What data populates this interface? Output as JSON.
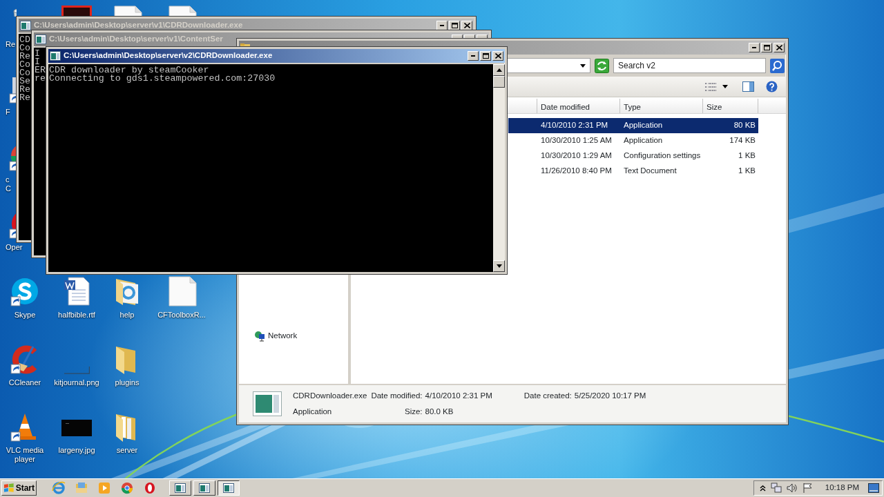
{
  "desktop_columns": [
    [
      {
        "kind": "recycle",
        "label": "Re",
        "cut": true
      },
      {
        "kind": "app",
        "label": "F",
        "cut": true,
        "shortcut": true
      },
      {
        "kind": "chrome",
        "label": "c\nC",
        "cut": true,
        "shortcut": true
      },
      {
        "kind": "opera",
        "label": "Oper",
        "cut": true,
        "shortcut": true
      },
      {
        "kind": "skype",
        "label": "Skype",
        "shortcut": true
      },
      {
        "kind": "ccleaner",
        "label": "CCleaner",
        "shortcut": true
      },
      {
        "kind": "vlc",
        "label": "VLC media player",
        "shortcut": true
      }
    ],
    [
      {
        "kind": "redapp"
      },
      {
        "kind": "worddoc",
        "label": "halfbible.rtf"
      },
      {
        "kind": "blankimage",
        "label": "kitjournal.png"
      },
      {
        "kind": "darkimage",
        "label": "largeny.jpg"
      }
    ],
    [
      {
        "kind": "document"
      },
      {
        "kind": "iefolder",
        "label": "help"
      },
      {
        "kind": "folder",
        "label": "plugins"
      },
      {
        "kind": "docfolder",
        "label": "server"
      }
    ],
    [
      {
        "kind": "document"
      },
      {
        "kind": "document",
        "label": "CFToolboxR..."
      }
    ]
  ],
  "windows": [
    {
      "kind": "console",
      "title": "C:\\Users\\admin\\Desktop\\server\\v1\\CDRDownloader.exe",
      "active": false,
      "lines": [
        "CD",
        "Co",
        "Re",
        "Co",
        "Co",
        "Se",
        "Re",
        "Re"
      ]
    },
    {
      "kind": "console",
      "title": "C:\\Users\\admin\\Desktop\\server\\v1\\ContentSer",
      "active": false,
      "lines": [
        "I",
        "I",
        "ER",
        "re"
      ]
    },
    {
      "kind": "explorer",
      "active": false,
      "search": {
        "placeholder": "Search v2"
      },
      "columns": [
        "Date modified",
        "Type",
        "Size"
      ],
      "rows": [
        {
          "date": "4/10/2010 2:31 PM",
          "type": "Application",
          "size": "80 KB",
          "selected": true
        },
        {
          "date": "10/30/2010 1:25 AM",
          "type": "Application",
          "size": "174 KB",
          "selected": false
        },
        {
          "date": "10/30/2010 1:29 AM",
          "type": "Configuration settings",
          "size": "1 KB",
          "selected": false
        },
        {
          "date": "11/26/2010 8:40 PM",
          "type": "Text Document",
          "size": "1 KB",
          "selected": false
        }
      ],
      "nav": [
        {
          "label": "Network"
        }
      ],
      "details": {
        "name": "CDRDownloader.exe",
        "type": "Application",
        "fields": [
          {
            "label": "Date modified:",
            "value": "4/10/2010 2:31 PM"
          },
          {
            "label": "Date created:",
            "value": "5/25/2020 10:17 PM"
          },
          {
            "label": "Size:",
            "value": "80.0 KB"
          }
        ]
      }
    },
    {
      "kind": "console",
      "title": "C:\\Users\\admin\\Desktop\\server\\v2\\CDRDownloader.exe",
      "active": true,
      "scrollbar": true,
      "lines": [
        "CDR downloader by steamCooker",
        "Connecting to gds1.steampowered.com:27030"
      ]
    }
  ],
  "taskbar": {
    "start": "Start",
    "quick_launch": [
      {
        "kind": "ie"
      },
      {
        "kind": "explorer"
      },
      {
        "kind": "media"
      },
      {
        "kind": "chrome"
      },
      {
        "kind": "opera"
      }
    ],
    "tasks": [
      {
        "selected": false
      },
      {
        "selected": false
      },
      {
        "selected": true
      }
    ],
    "clock": "10:18 PM"
  }
}
